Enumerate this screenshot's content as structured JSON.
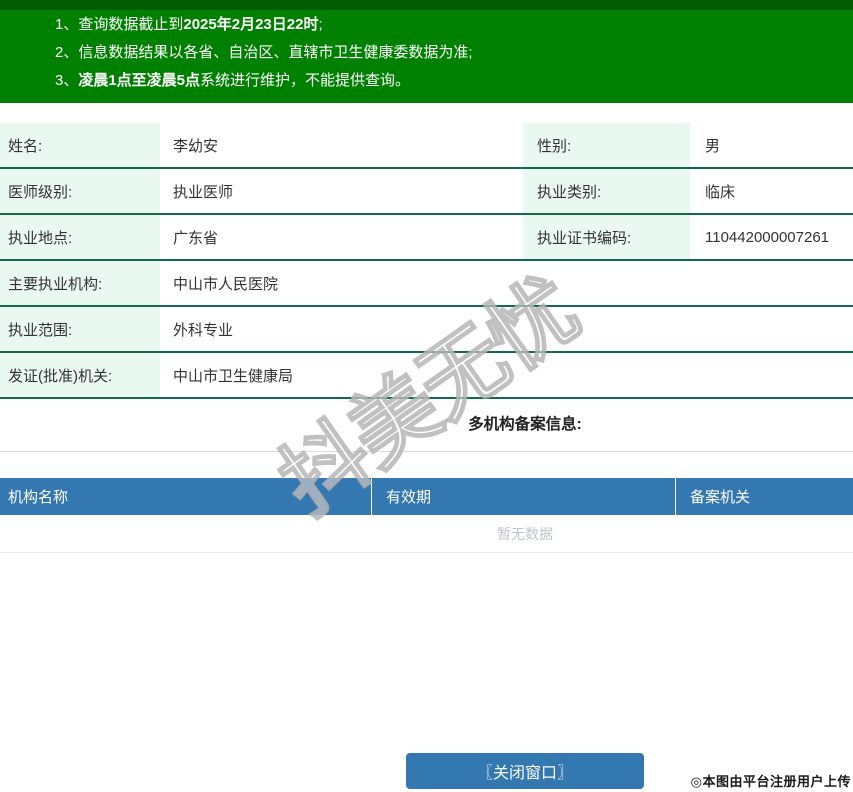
{
  "colors": {
    "banner_green": "#008000",
    "banner_green_dark": "#005c00",
    "row_border_green": "#116b4e",
    "label_cell_bg": "#e9f8f0",
    "accent_blue": "#3478b2",
    "empty_text_gray": "#c0c4cc"
  },
  "notice": {
    "line1_num": "1、",
    "line1_pre": "查询数据截止到",
    "line1_bold": "2025年2月23日22时",
    "line1_post": ";",
    "line2_num": "2、",
    "line2_text": "信息数据结果以各省、自治区、直辖市卫生健康委数据为准;",
    "line3_num": "3、",
    "line3_bold": "凌晨1点至凌晨5点",
    "line3_post": "系统进行维护，不能提供查询。"
  },
  "info": {
    "rows": [
      {
        "label1": "姓名:",
        "value1": "李幼安",
        "label2": "性别:",
        "value2": "男"
      },
      {
        "label1": "医师级别:",
        "value1": "执业医师",
        "label2": "执业类别:",
        "value2": "临床"
      },
      {
        "label1": "执业地点:",
        "value1": "广东省",
        "label2": "执业证书编码:",
        "value2": "110442000007261"
      },
      {
        "label1": "主要执业机构:",
        "value1": "中山市人民医院"
      },
      {
        "label1": "执业范围:",
        "value1": "外科专业"
      },
      {
        "label1": "发证(批准)机关:",
        "value1": "中山市卫生健康局"
      }
    ]
  },
  "records": {
    "title": "多机构备案信息:",
    "columns": [
      "机构名称",
      "有效期",
      "备案机关"
    ],
    "empty_text": "暂无数据",
    "rows": []
  },
  "watermark": {
    "text": "抖美无忧"
  },
  "footer": {
    "close_label": "〖关闭窗口〗",
    "credit": "◎本图由平台注册用户上传"
  }
}
